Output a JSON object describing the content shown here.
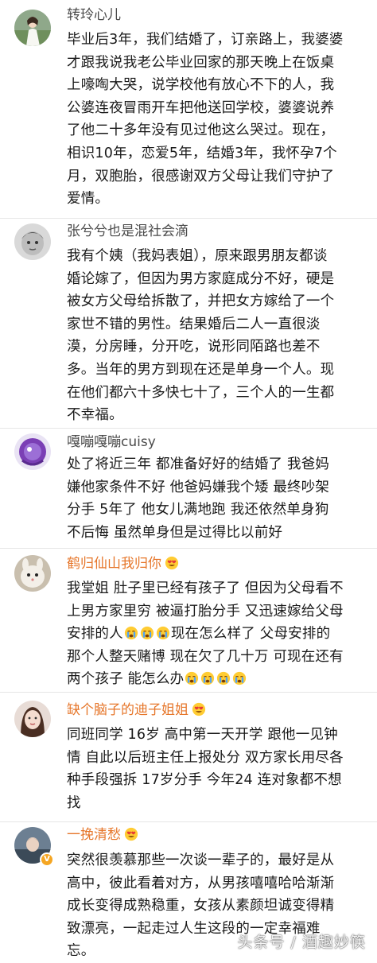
{
  "comments": [
    {
      "username": "转玲心儿",
      "lines": [
        "毕业后3年，我们结婚了，订亲路上，我婆婆",
        "才跟我说我老公毕业回家的那天晚上在饭桌",
        "上嚎啕大哭，说学校他有放心不下的人，我",
        "公婆连夜冒雨开车把他送回学校，婆婆说养",
        "了他二十多年没有见过他这么哭过。现在，",
        "相识10年，恋爱5年，结婚3年，我怀孕7个",
        "月，双胞胎，很感谢双方父母让我们守护了",
        "爱情。"
      ]
    },
    {
      "username": "张兮兮也是混社会滴",
      "lines": [
        "我有个姨（我妈表姐），原来跟男朋友都谈",
        "婚论嫁了，但因为男方家庭成分不好，硬是",
        "被女方父母给拆散了，并把女方嫁给了一个",
        "家世不错的男性。结果婚后二人一直很淡",
        "漠，分房睡，分开吃，说形同陌路也差不",
        "多。当年的男方到现在还是单身一个人。现",
        "在他们都六十多快七十了，三个人的一生都",
        "不幸福。"
      ]
    },
    {
      "username": "嘎嘣嘎嘣cuisy",
      "lines": [
        "处了将近三年  都准备好好的结婚了  我爸妈",
        "嫌他家条件不好  他爸妈嫌我个矮  最终吵架",
        "分手   5年了  他女儿满地跑  我还依然单身狗",
        "不后悔   虽然单身但是过得比以前好"
      ]
    },
    {
      "username": "鹤归仙山我归你",
      "lines_a": [
        "我堂姐  肚子里已经有孩子了  但因为父母看不",
        "上男方家里穷  被逼打胎分手  又迅速嫁给父母"
      ],
      "line3_pre": "安排的人",
      "line3_post": "现在怎么样了  父母安排的",
      "lines_b": [
        "那个人整天赌博  现在欠了几十万  可现在还有"
      ],
      "line5_pre": "两个孩子  能怎么办"
    },
    {
      "username": "缺个脑子的迪子姐姐",
      "lines": [
        "同班同学   16岁  高中第一天开学  跟他一见钟",
        "情  自此以后班主任上报处分  双方家长用尽各",
        "种手段强拆  17岁分手  今年24  连对象都不想",
        "找"
      ]
    },
    {
      "username": "一挽清愁",
      "verified_mark": "V",
      "lines": [
        "突然很羡慕那些一次谈一辈子的，最好是从",
        "高中，彼此看着对方，从男孩嘻嘻哈哈渐渐",
        "成长变得成熟稳重，女孩从素颜坦诚变得精",
        "致漂亮，一起走过人生这段的一定幸福难",
        "忘。"
      ]
    }
  ],
  "watermark": "头条号 / 酒趣妙筷",
  "colors": {
    "username_plain": "#4a4a4a",
    "username_vip": "#e6762a",
    "body_text": "#1a1a1a",
    "divider": "#e6e6e6",
    "verified_badge": "#f5a623"
  },
  "icons": {
    "heart_eyes": "heart-eyes-emoji-icon",
    "crying": "crying-emoji-icon",
    "verified": "verified-badge-icon"
  }
}
